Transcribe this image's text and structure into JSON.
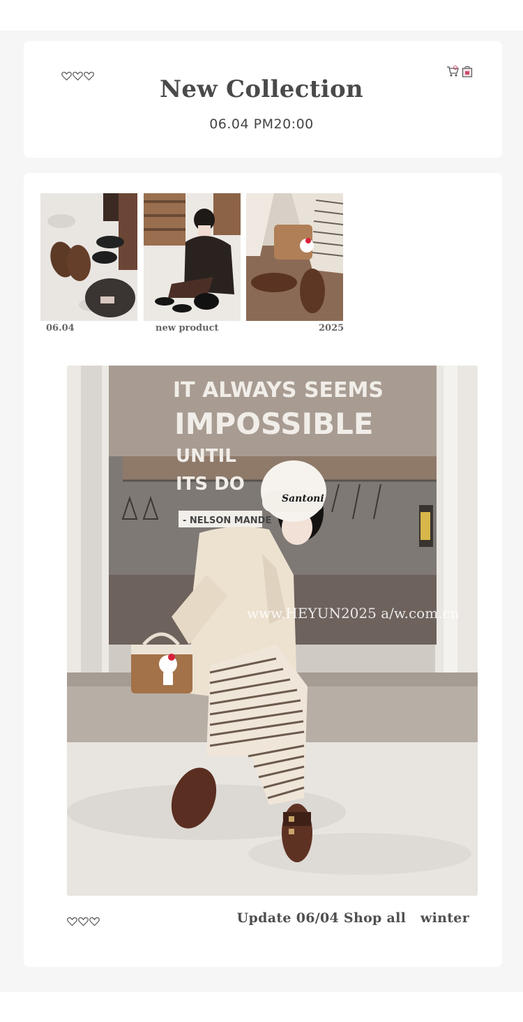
{
  "header": {
    "title": "New Collection",
    "datetime": "06.04 PM20:00",
    "icons": [
      "heart-outline-icon",
      "heart-outline-icon",
      "heart-outline-icon",
      "shopping-cart-icon",
      "shopping-bag-icon"
    ]
  },
  "gallery": {
    "thumbnails": [
      {
        "caption": "06.04",
        "subject": "loafers-and-bag-on-snow"
      },
      {
        "caption": "new product",
        "subject": "model-sitting-in-black-beanie"
      },
      {
        "caption": "2025",
        "subject": "loafers-and-hello-kitty-bag"
      }
    ]
  },
  "hero": {
    "sign_lines": [
      "IT ALWAYS SEEMS",
      "IMPOSSIBLE",
      "UNTIL",
      "ITS DO",
      "- NELSON MANDE"
    ],
    "beanie_text": "Santoni",
    "watermark": "www.HEYUN2025 a/w.com.cn"
  },
  "footer": {
    "update_text": "Update 06/04 Shop all   winter"
  },
  "colors": {
    "page_bg": "#f6f6f6",
    "card_bg": "#ffffff",
    "text": "#4a4a4a"
  }
}
